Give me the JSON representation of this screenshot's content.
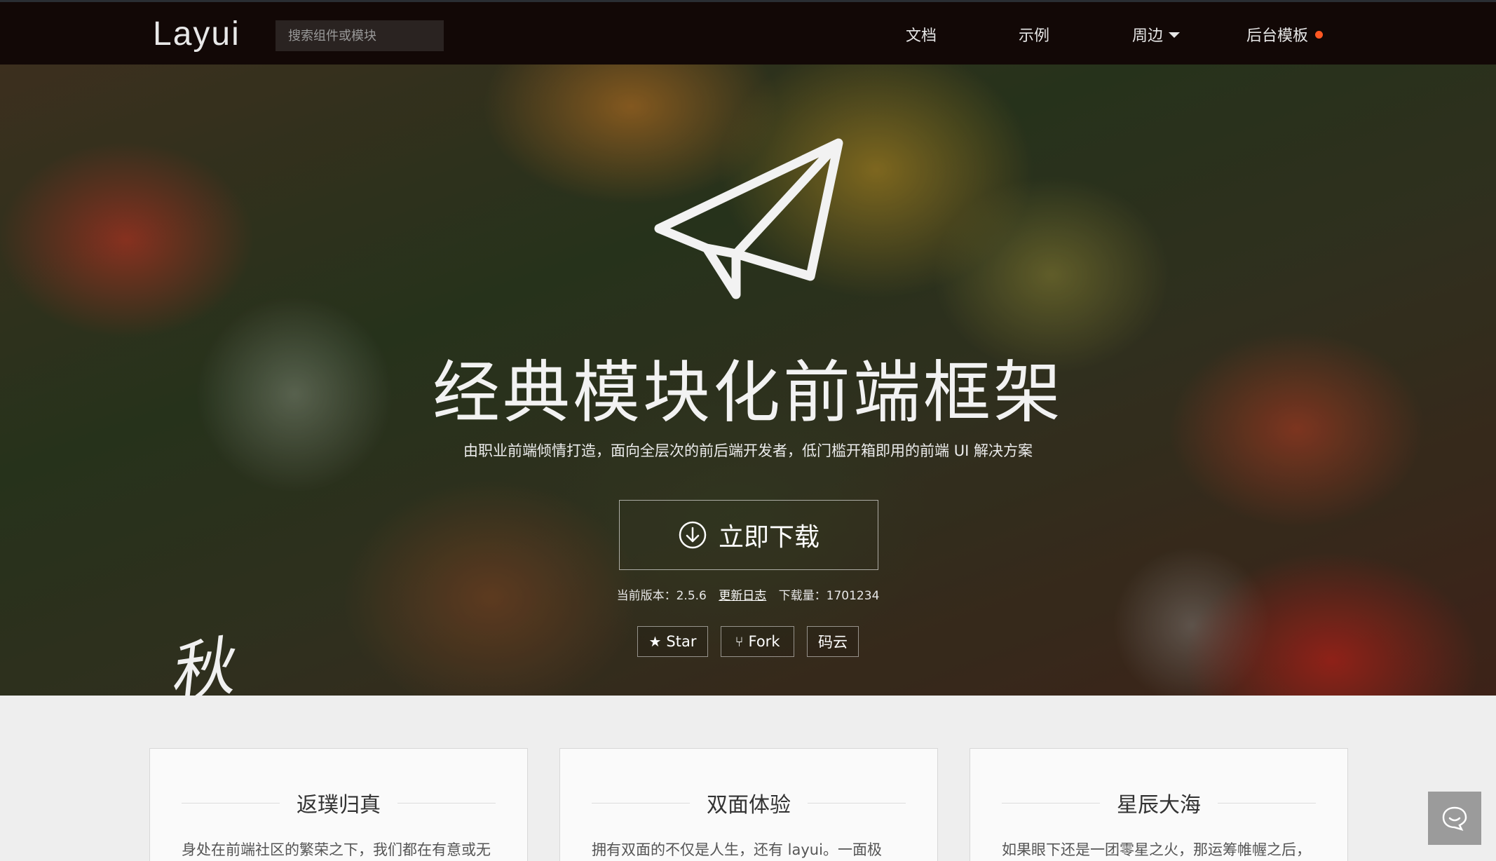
{
  "header": {
    "logo": "Layui",
    "search_placeholder": "搜索组件或模块",
    "nav": [
      {
        "label": "文档"
      },
      {
        "label": "示例"
      },
      {
        "label": "周边"
      },
      {
        "label": "后台模板"
      }
    ],
    "admin_dot_color": "#ff5722"
  },
  "hero": {
    "icon": "paper-plane-icon",
    "title": "经典模块化前端框架",
    "subtitle": "由职业前端倾情打造，面向全层次的前后端开发者，低门槛开箱即用的前端 UI 解决方案",
    "download_label": "立即下载",
    "version_prefix": "当前版本：",
    "version": "2.5.6",
    "changelog": "更新日志",
    "downloads_prefix": "下载量：",
    "downloads": "1701234",
    "star_label": "Star",
    "fork_label": "Fork",
    "gitee_label": "码云",
    "season": "秋"
  },
  "cards": [
    {
      "title": "返璞归真",
      "text": "身处在前端社区的繁荣之下，我们都在有意或无"
    },
    {
      "title": "双面体验",
      "text": "拥有双面的不仅是人生，还有 layui。一面极"
    },
    {
      "title": "星辰大海",
      "text": "如果眼下还是一团零星之火，那运筹帷幄之后，"
    }
  ],
  "chat_widget": {
    "icon": "chat-bubble-icon"
  }
}
